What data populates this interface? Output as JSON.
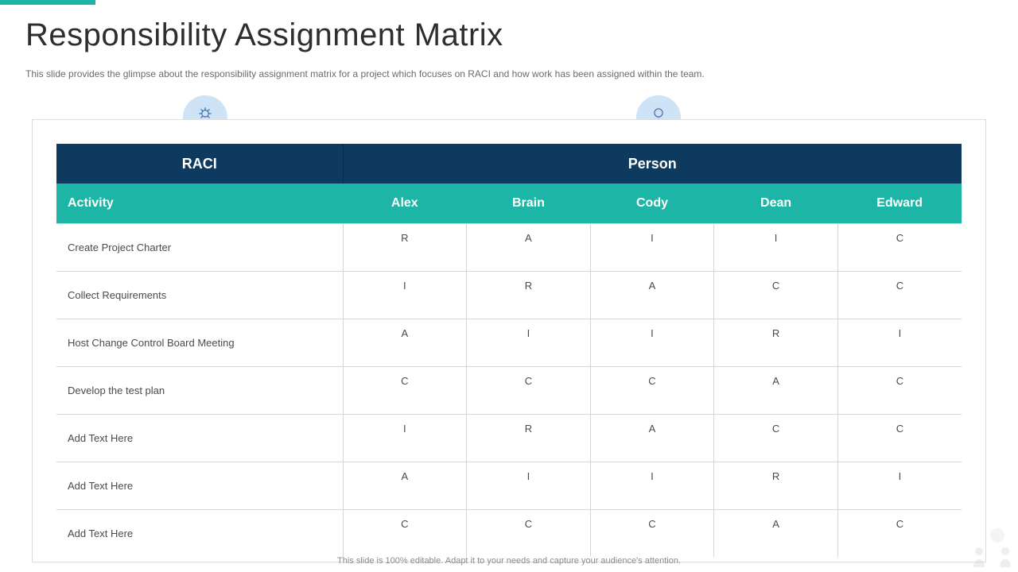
{
  "title": "Responsibility Assignment Matrix",
  "subtitle": "This slide provides the glimpse about the responsibility assignment matrix for a project which focuses on RACI and how work has been assigned within the team.",
  "header1": {
    "raci": "RACI",
    "person": "Person"
  },
  "header2": {
    "activity": "Activity",
    "people": [
      "Alex",
      "Brain",
      "Cody",
      "Dean",
      "Edward"
    ]
  },
  "rows": [
    {
      "activity": "Create Project Charter",
      "cells": [
        "R",
        "A",
        "I",
        "I",
        "C"
      ]
    },
    {
      "activity": "Collect Requirements",
      "cells": [
        "I",
        "R",
        "A",
        "C",
        "C"
      ]
    },
    {
      "activity": "Host Change Control Board Meeting",
      "cells": [
        "A",
        "I",
        "I",
        "R",
        "I"
      ]
    },
    {
      "activity": "Develop the test plan",
      "cells": [
        "C",
        "C",
        "C",
        "A",
        "C"
      ]
    },
    {
      "activity": "Add Text Here",
      "cells": [
        "I",
        "R",
        "A",
        "C",
        "C"
      ]
    },
    {
      "activity": "Add Text Here",
      "cells": [
        "A",
        "I",
        "I",
        "R",
        "I"
      ]
    },
    {
      "activity": "Add Text Here",
      "cells": [
        "C",
        "C",
        "C",
        "A",
        "C"
      ]
    }
  ],
  "footer": "This slide is 100% editable. Adapt it to your needs and capture your audience's attention.",
  "chart_data": {
    "type": "table",
    "title": "Responsibility Assignment Matrix",
    "columns": [
      "Activity",
      "Alex",
      "Brain",
      "Cody",
      "Dean",
      "Edward"
    ],
    "rows": [
      [
        "Create Project Charter",
        "R",
        "A",
        "I",
        "I",
        "C"
      ],
      [
        "Collect Requirements",
        "I",
        "R",
        "A",
        "C",
        "C"
      ],
      [
        "Host Change Control Board Meeting",
        "A",
        "I",
        "I",
        "R",
        "I"
      ],
      [
        "Develop the test plan",
        "C",
        "C",
        "C",
        "A",
        "C"
      ],
      [
        "Add Text Here",
        "I",
        "R",
        "A",
        "C",
        "C"
      ],
      [
        "Add Text Here",
        "A",
        "I",
        "I",
        "R",
        "I"
      ],
      [
        "Add Text Here",
        "C",
        "C",
        "C",
        "A",
        "C"
      ]
    ]
  }
}
